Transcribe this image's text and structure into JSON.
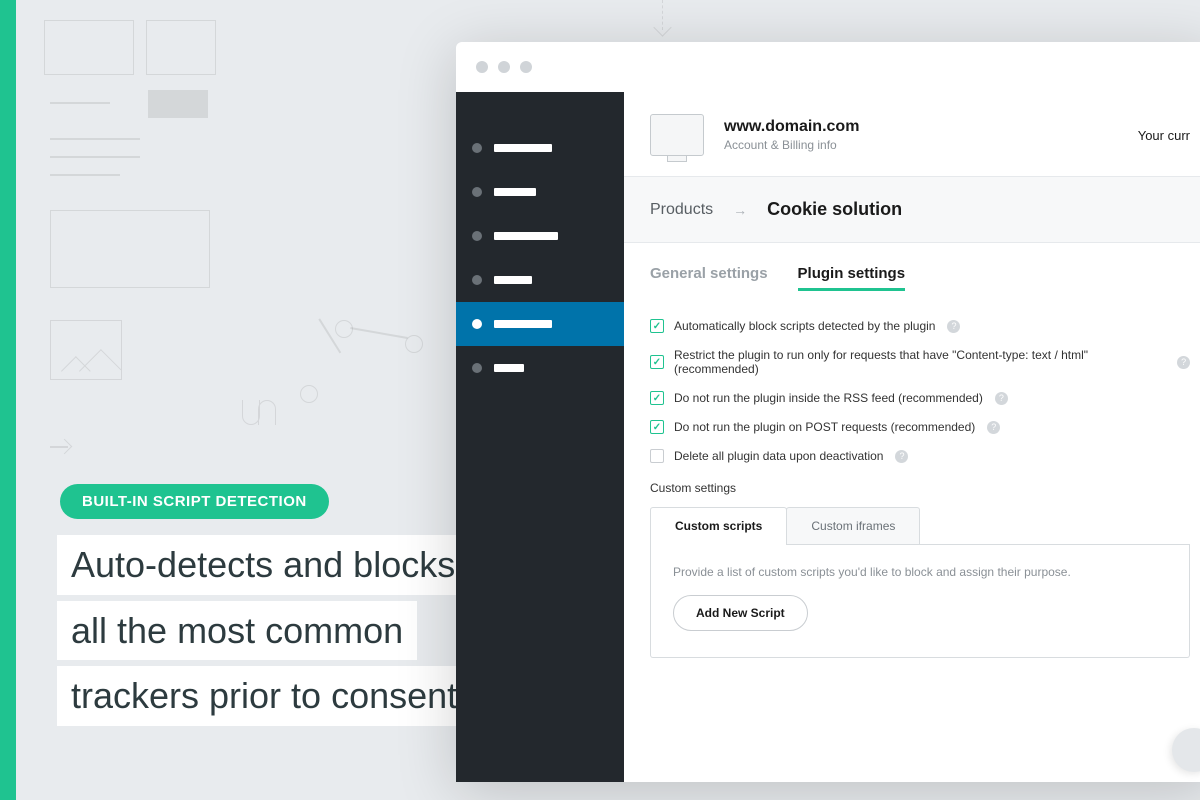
{
  "promo": {
    "badge": "BUILT-IN SCRIPT DETECTION",
    "line1": "Auto-detects and blocks",
    "line2": "all the most common",
    "line3": "trackers prior to consent"
  },
  "header": {
    "domain": "www.domain.com",
    "sub": "Account & Billing info",
    "plan": "Your curr"
  },
  "breadcrumb": {
    "products": "Products",
    "current": "Cookie solution"
  },
  "tabs": {
    "general": "General settings",
    "plugin": "Plugin settings"
  },
  "options": {
    "opt1": "Automatically block scripts detected by the plugin",
    "opt2": "Restrict the plugin to run only for requests that have \"Content-type: text / html\" (recommended)",
    "opt3": "Do not run the plugin inside the RSS feed (recommended)",
    "opt4": "Do not run the plugin on POST requests (recommended)",
    "opt5": "Delete all plugin data upon deactivation"
  },
  "custom": {
    "heading": "Custom settings",
    "tab_scripts": "Custom scripts",
    "tab_iframes": "Custom iframes",
    "desc": "Provide a list of custom scripts you'd like to block and assign their purpose.",
    "add_btn": "Add New Script"
  }
}
